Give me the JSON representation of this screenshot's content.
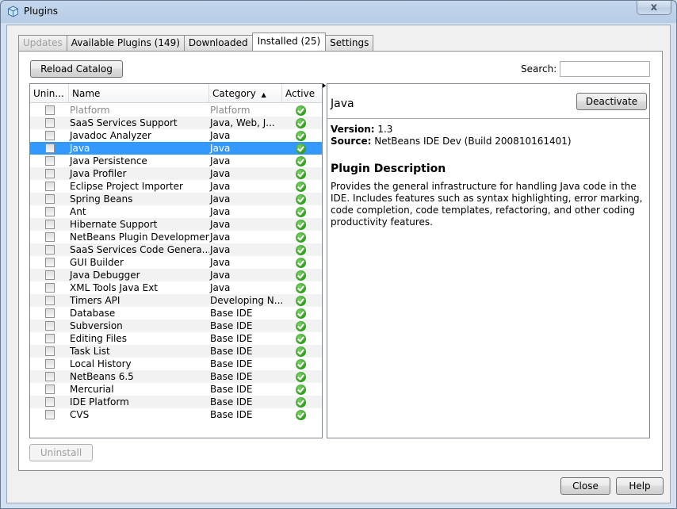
{
  "window": {
    "title": "Plugins",
    "close_glyph": "x"
  },
  "tabs": [
    {
      "label": "Updates",
      "state": "disabled"
    },
    {
      "label": "Available Plugins (149)",
      "state": "normal"
    },
    {
      "label": "Downloaded",
      "state": "normal"
    },
    {
      "label": "Installed (25)",
      "state": "active"
    },
    {
      "label": "Settings",
      "state": "normal"
    }
  ],
  "toolbar": {
    "reload_label": "Reload Catalog",
    "search_label": "Search:",
    "search_value": ""
  },
  "table": {
    "columns": {
      "uninstall": "Unin...",
      "name": "Name",
      "category": "Category",
      "active": "Active"
    },
    "sort_indicator": "▲",
    "rows": [
      {
        "name": "Platform",
        "category": "Platform",
        "dim": true
      },
      {
        "name": "SaaS Services Support",
        "category": "Java, Web, J..."
      },
      {
        "name": "Javadoc Analyzer",
        "category": "Java"
      },
      {
        "name": "Java",
        "category": "Java",
        "selected": true
      },
      {
        "name": "Java Persistence",
        "category": "Java"
      },
      {
        "name": "Java Profiler",
        "category": "Java"
      },
      {
        "name": "Eclipse Project Importer",
        "category": "Java"
      },
      {
        "name": "Spring Beans",
        "category": "Java"
      },
      {
        "name": "Ant",
        "category": "Java"
      },
      {
        "name": "Hibernate Support",
        "category": "Java"
      },
      {
        "name": "NetBeans Plugin Development",
        "category": "Java"
      },
      {
        "name": "SaaS Services Code Genera...",
        "category": "Java"
      },
      {
        "name": "GUI Builder",
        "category": "Java"
      },
      {
        "name": "Java Debugger",
        "category": "Java"
      },
      {
        "name": "XML Tools Java Ext",
        "category": "Java"
      },
      {
        "name": "Timers API",
        "category": "Developing N..."
      },
      {
        "name": "Database",
        "category": "Base IDE"
      },
      {
        "name": "Subversion",
        "category": "Base IDE"
      },
      {
        "name": "Editing Files",
        "category": "Base IDE"
      },
      {
        "name": "Task List",
        "category": "Base IDE"
      },
      {
        "name": "Local History",
        "category": "Base IDE"
      },
      {
        "name": "NetBeans 6.5",
        "category": "Base IDE"
      },
      {
        "name": "Mercurial",
        "category": "Base IDE"
      },
      {
        "name": "IDE Platform",
        "category": "Base IDE"
      },
      {
        "name": "CVS",
        "category": "Base IDE"
      }
    ]
  },
  "detail": {
    "title": "Java",
    "deactivate_label": "Deactivate",
    "version_label": "Version:",
    "version_value": "1.3",
    "source_label": "Source:",
    "source_value": "NetBeans IDE Dev (Build 200810161401)",
    "description_title": "Plugin Description",
    "description": "Provides the general infrastructure for handling Java code in the IDE. Includes features such as syntax highlighting, error marking, code completion, code templates, refactoring, and other coding productivity features."
  },
  "footer": {
    "uninstall_label": "Uninstall",
    "close_label": "Close",
    "help_label": "Help"
  },
  "colors": {
    "selection": "#3399ff",
    "active_check": "#2c9c1a"
  },
  "icons": {
    "window_icon": "netbeans-cube-icon",
    "active_status": "check-circle-icon"
  }
}
